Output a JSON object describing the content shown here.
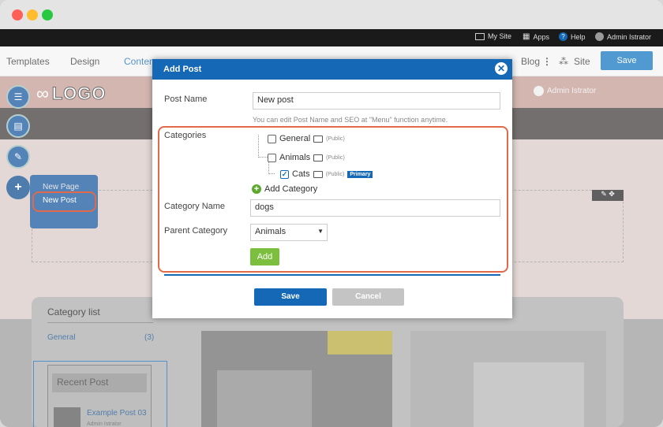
{
  "adminbar": {
    "my_site": "My Site",
    "apps": "Apps",
    "help": "Help",
    "user": "Admin Istrator"
  },
  "toolbar": {
    "templates": "Templates",
    "design": "Design",
    "contents": "Conten",
    "blog": "Blog",
    "site": "Site",
    "save": "Save"
  },
  "site": {
    "logo_text": "LOGO",
    "user_ghost": "Admin Istrator"
  },
  "sidebar_menu": {
    "new_page": "New Page",
    "new_post": "New Post"
  },
  "category_list": {
    "title": "Category list",
    "items": [
      {
        "name": "General",
        "count": "(3)"
      }
    ]
  },
  "recent_post": {
    "title": "Recent Post",
    "items": [
      {
        "title": "Example Post 03",
        "meta": "Admin Istrator"
      }
    ]
  },
  "modal": {
    "title": "Add Post",
    "post_name_label": "Post Name",
    "post_name_value": "New post",
    "hint": "You can edit Post Name and SEO at \"Menu\" function anytime.",
    "categories_label": "Categories",
    "categories": [
      {
        "name": "General",
        "visibility": "(Public)",
        "checked": false
      },
      {
        "name": "Animals",
        "visibility": "(Public)",
        "checked": false
      },
      {
        "name": "Cats",
        "visibility": "(Public)",
        "checked": true,
        "badge": "Primary"
      }
    ],
    "add_category": "Add Category",
    "category_name_label": "Category Name",
    "category_name_value": "dogs",
    "parent_category_label": "Parent Category",
    "parent_category_value": "Animals",
    "add_button": "Add",
    "save_button": "Save",
    "cancel_button": "Cancel"
  },
  "colors": {
    "primary": "#1468b5",
    "highlight": "#e06a4a",
    "add_green": "#7cbf3f",
    "cancel_gray": "#c4c4c4"
  }
}
